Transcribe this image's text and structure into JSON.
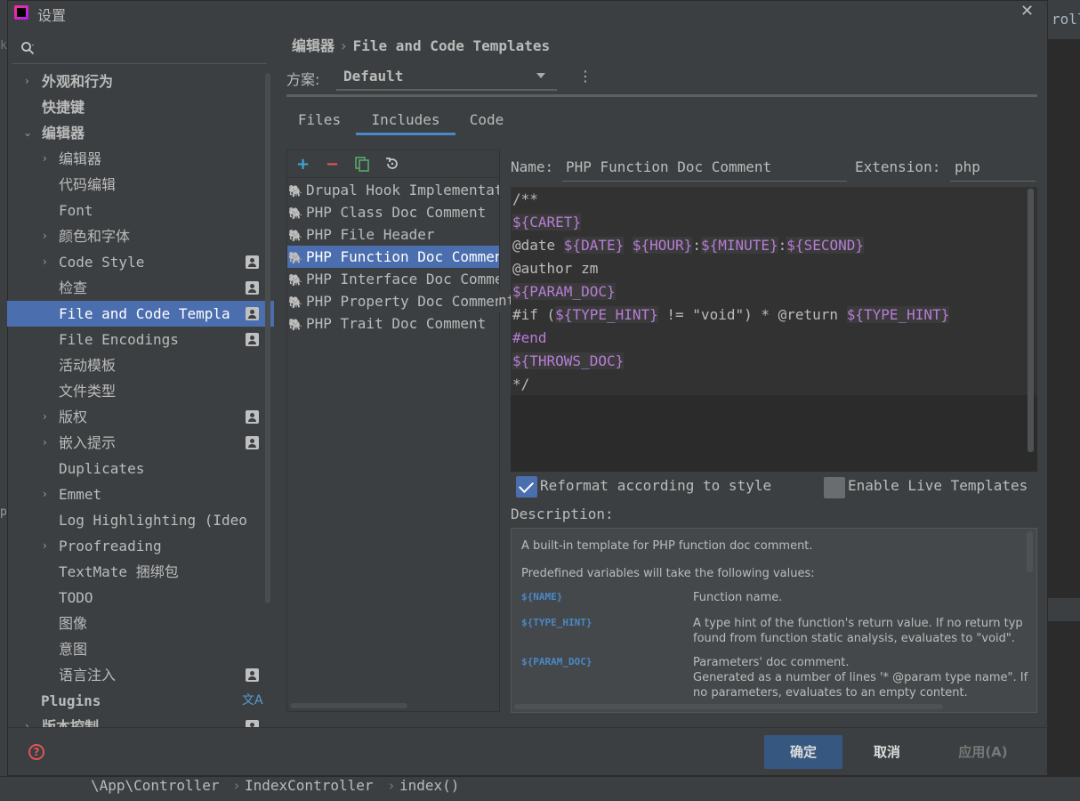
{
  "window": {
    "title": "设置"
  },
  "tree": {
    "items": [
      {
        "label": "外观和行为",
        "arrow": "›",
        "bold": true
      },
      {
        "label": "快捷键",
        "bold": true
      },
      {
        "label": "编辑器",
        "arrow": "⌄",
        "bold": true
      },
      {
        "label": "编辑器",
        "arrow": "›"
      },
      {
        "label": "代码编辑"
      },
      {
        "label": "Font"
      },
      {
        "label": "颜色和字体",
        "arrow": "›"
      },
      {
        "label": "Code Style",
        "arrow": "›"
      },
      {
        "label": "检查"
      },
      {
        "label": "File and Code Templa"
      },
      {
        "label": "File Encodings"
      },
      {
        "label": "活动模板"
      },
      {
        "label": "文件类型"
      },
      {
        "label": "版权",
        "arrow": "›"
      },
      {
        "label": "嵌入提示",
        "arrow": "›"
      },
      {
        "label": "Duplicates"
      },
      {
        "label": "Emmet",
        "arrow": "›"
      },
      {
        "label": "Log Highlighting (Ideo"
      },
      {
        "label": "Proofreading",
        "arrow": "›"
      },
      {
        "label": "TextMate 捆绑包"
      },
      {
        "label": "TODO"
      },
      {
        "label": "图像"
      },
      {
        "label": "意图"
      },
      {
        "label": "语言注入"
      },
      {
        "label": "Plugins",
        "bold": true
      },
      {
        "label": "版本控制",
        "arrow": "›",
        "bold": true
      }
    ]
  },
  "header": {
    "crumb_parent": "编辑器",
    "crumb_sep": "›",
    "crumb_current": "File and Code Templates"
  },
  "scheme": {
    "label": "方案:",
    "value": "Default",
    "menu_icon": "⋮"
  },
  "tabs": [
    "Files",
    "Includes",
    "Code"
  ],
  "toolbar": {
    "add": "+",
    "remove": "−"
  },
  "templates": [
    "Drupal Hook Implementation",
    "PHP Class Doc Comment",
    "PHP File Header",
    "PHP Function Doc Comment",
    "PHP Interface Doc Comment",
    "PHP Property Doc Comment",
    "PHP Trait Doc Comment"
  ],
  "editor_fields": {
    "name_label": "Name:",
    "name_value": "PHP Function Doc Comment",
    "ext_label": "Extension:",
    "ext_value": "php"
  },
  "code": {
    "l1": "/**",
    "l2": "${CARET}",
    "l3a": "@date ",
    "l3b": "${DATE}",
    "l3c": " ",
    "l3d": "${HOUR}",
    "l3e": ":",
    "l3f": "${MINUTE}",
    "l3g": ":",
    "l3h": "${SECOND}",
    "l4": "@author zm",
    "l5": "${PARAM_DOC}",
    "l6a": "#if (",
    "l6b": "${TYPE_HINT}",
    "l6c": " != \"void\") * @return ",
    "l6d": "${TYPE_HINT}",
    "l7": "#end",
    "l8": "${THROWS_DOC}",
    "l9": "*/"
  },
  "options": {
    "reformat": "Reformat according to style",
    "live_templates": "Enable Live Templates"
  },
  "description": {
    "label": "Description:",
    "intro": "A built-in template for PHP function doc comment.",
    "predef": "Predefined variables will take the following values:",
    "vars": [
      {
        "name": "${NAME}",
        "desc1": "Function name.",
        "desc2": "",
        "desc3": ""
      },
      {
        "name": "${TYPE_HINT}",
        "desc1": "A type hint of the function's return value. If no return typ",
        "desc2": "found from function static analysis, evaluates to \"void\".",
        "desc3": ""
      },
      {
        "name": "${PARAM_DOC}",
        "desc1": "Parameters' doc comment.",
        "desc2": "Generated as a number of lines '* @param type name\". If",
        "desc3": "no parameters, evaluates to an empty content."
      }
    ]
  },
  "footer": {
    "help_icon": "?",
    "ok": "确定",
    "cancel": "取消",
    "apply": "应用(A)"
  },
  "statusbar": {
    "p1": "\\App\\Controller",
    "sep": "›",
    "p2": "IndexController",
    "p3": "index()"
  },
  "background": {
    "right_text": "roll",
    "left_k": "k",
    "left_p": "p"
  }
}
